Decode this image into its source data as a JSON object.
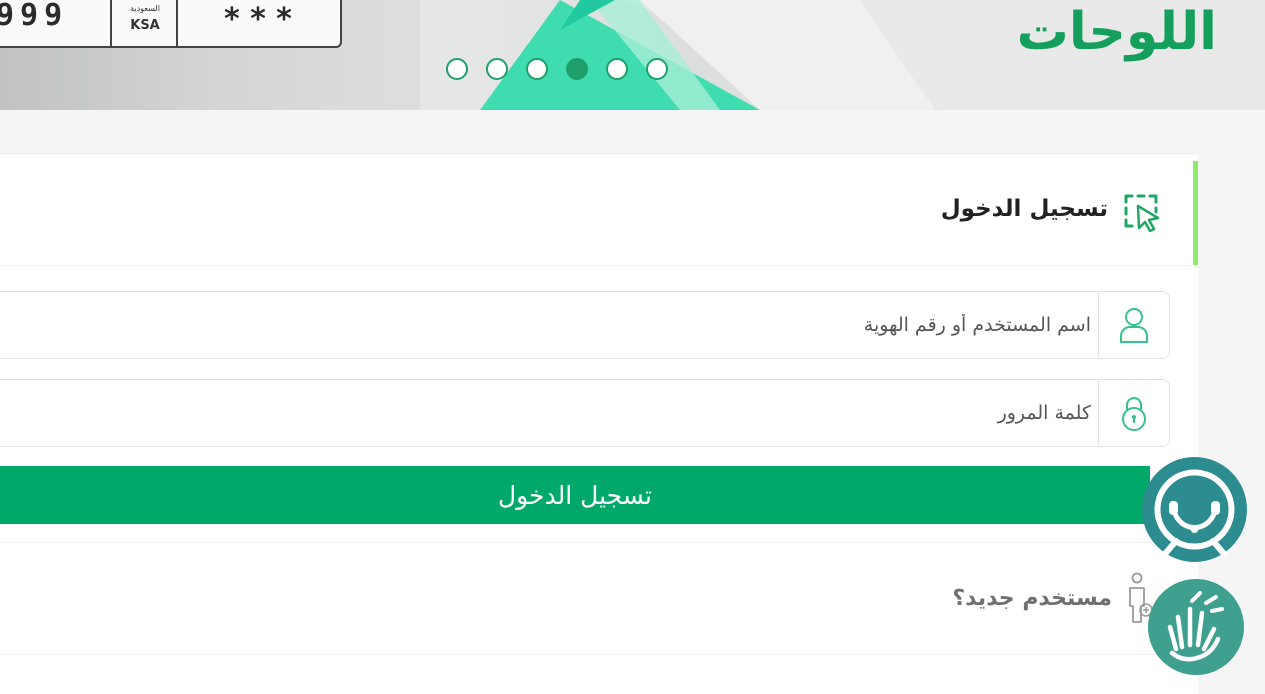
{
  "banner": {
    "plate": {
      "digits": "999",
      "country_small": "السعودية",
      "country_code": "KSA",
      "stars": "***"
    },
    "slider_dots": [
      {
        "active": false
      },
      {
        "active": false
      },
      {
        "active": false
      },
      {
        "active": true
      },
      {
        "active": false
      },
      {
        "active": false
      }
    ],
    "brand_name": "اللوحات"
  },
  "login": {
    "title": "تسجيل الدخول",
    "title_icon": "cursor-select-icon",
    "username_placeholder": "اسم المستخدم أو رقم الهوية",
    "username_icon": "user-icon",
    "password_placeholder": "كلمة المرور",
    "password_icon": "lock-icon",
    "submit_label": "تسجيل الدخول"
  },
  "new_user": {
    "label": "مستخدم جديد؟",
    "icon": "new-user-icon"
  },
  "floating_buttons": [
    {
      "icon": "support-chat-icon"
    },
    {
      "icon": "sign-language-icon"
    }
  ],
  "colors": {
    "primary": "#00a86a",
    "brand": "#14a05c",
    "accent": "#8ee86a",
    "support": "#2d8c8f",
    "sign_language": "#3fa08f"
  }
}
